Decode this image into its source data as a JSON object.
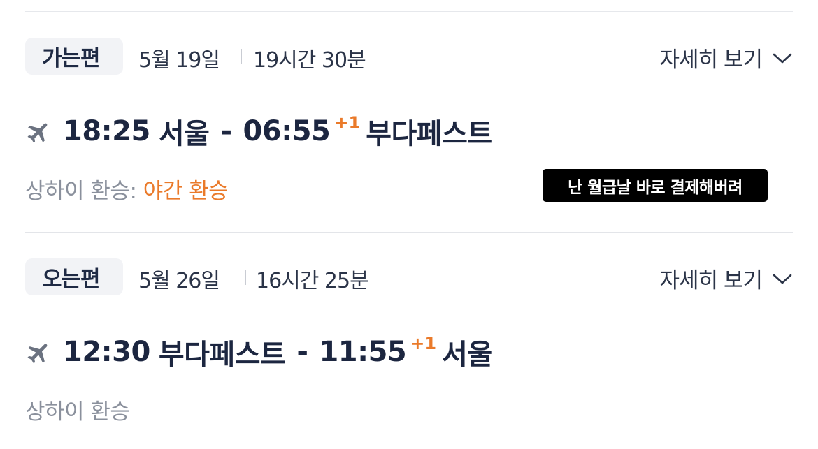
{
  "outbound": {
    "badge": "가는편",
    "date": "5월 19일",
    "duration": "19시간 30분",
    "details_label": "자세히 보기",
    "depart_time": "18:25",
    "depart_city": "서울",
    "separator": "-",
    "arrive_time": "06:55",
    "day_offset": "+1",
    "arrive_city": "부다페스트",
    "transfer_label": "상하이 환승:",
    "transfer_note": "야간 환승"
  },
  "inbound": {
    "badge": "오는편",
    "date": "5월 26일",
    "duration": "16시간 25분",
    "details_label": "자세히 보기",
    "depart_time": "12:30",
    "depart_city": "부다페스트",
    "separator": "-",
    "arrive_time": "11:55",
    "day_offset": "+1",
    "arrive_city": "서울",
    "transfer_label": "상하이 환승"
  },
  "overlay_caption": "난 월급날 바로 결제해버려",
  "colors": {
    "accent_orange": "#ea7a2a",
    "text_dark": "#1c2640",
    "text_muted": "#8a909c",
    "badge_bg": "#f2f3f6"
  },
  "icons": [
    "airplane-icon",
    "chevron-down-icon"
  ]
}
